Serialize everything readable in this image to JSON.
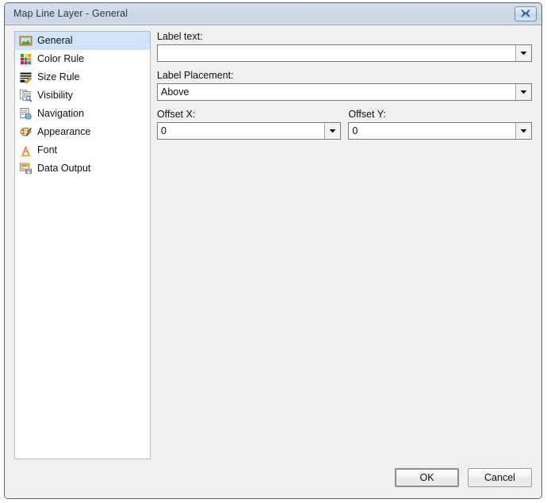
{
  "window": {
    "title": "Map Line Layer - General",
    "close_icon": "close-icon"
  },
  "sidebar": {
    "items": [
      {
        "label": "General",
        "icon": "picture-icon",
        "selected": true
      },
      {
        "label": "Color Rule",
        "icon": "color-grid-icon",
        "selected": false
      },
      {
        "label": "Size Rule",
        "icon": "size-pencil-icon",
        "selected": false
      },
      {
        "label": "Visibility",
        "icon": "document-search-icon",
        "selected": false
      },
      {
        "label": "Navigation",
        "icon": "document-globe-icon",
        "selected": false
      },
      {
        "label": "Appearance",
        "icon": "palette-icon",
        "selected": false
      },
      {
        "label": "Font",
        "icon": "font-a-icon",
        "selected": false
      },
      {
        "label": "Data Output",
        "icon": "data-output-icon",
        "selected": false
      }
    ]
  },
  "panel": {
    "label_text": {
      "label": "Label text:",
      "value": "",
      "placeholder": ""
    },
    "label_placement": {
      "label": "Label Placement:",
      "value": "Above"
    },
    "offset_x": {
      "label": "Offset X:",
      "value": "0"
    },
    "offset_y": {
      "label": "Offset Y:",
      "value": "0"
    }
  },
  "footer": {
    "ok_label": "OK",
    "cancel_label": "Cancel"
  },
  "colors": {
    "titlebar": "#ccd9e7",
    "selection": "#cfe4fa",
    "background": "#f0f0f0",
    "accent_orange": "#e8820c"
  }
}
